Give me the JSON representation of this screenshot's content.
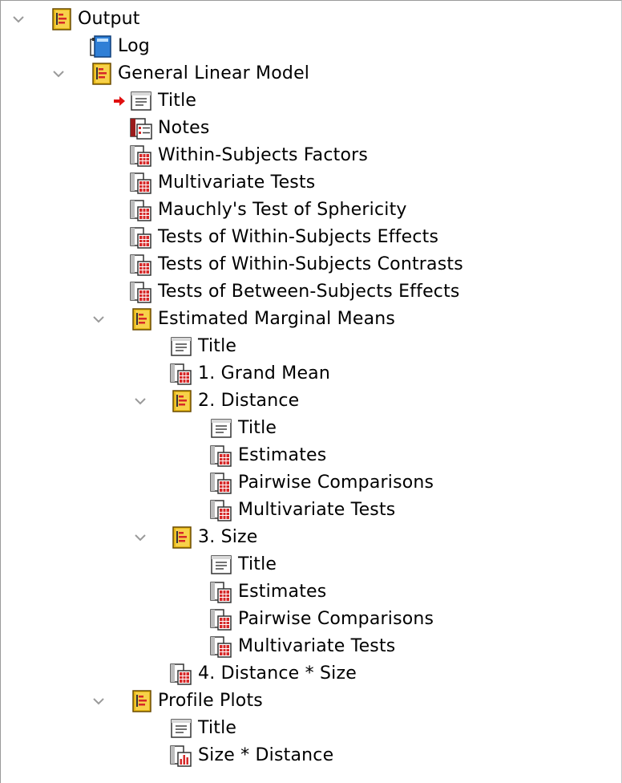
{
  "tree": {
    "root": {
      "label": "Output",
      "icon": "output-book-icon"
    },
    "log": {
      "label": "Log",
      "icon": "log-book-icon"
    },
    "glm": {
      "label": "General Linear Model",
      "icon": "procedure-book-icon",
      "items": [
        {
          "label": "Title",
          "icon": "title-icon",
          "selected_marker": "red-arrow-icon"
        },
        {
          "label": "Notes",
          "icon": "notes-icon"
        },
        {
          "label": "Within-Subjects Factors",
          "icon": "table-icon"
        },
        {
          "label": "Multivariate Tests",
          "icon": "table-icon"
        },
        {
          "label": "Mauchly's Test of Sphericity",
          "icon": "table-icon"
        },
        {
          "label": "Tests of Within-Subjects Effects",
          "icon": "table-icon"
        },
        {
          "label": "Tests of Within-Subjects Contrasts",
          "icon": "table-icon"
        },
        {
          "label": "Tests of Between-Subjects Effects",
          "icon": "table-icon"
        }
      ],
      "emm": {
        "label": "Estimated Marginal Means",
        "icon": "procedure-book-icon",
        "title": "Title",
        "grand_mean": "1. Grand Mean",
        "distance": {
          "label": "2. Distance",
          "items": [
            "Title",
            "Estimates",
            "Pairwise Comparisons",
            "Multivariate Tests"
          ]
        },
        "size": {
          "label": "3. Size",
          "items": [
            "Title",
            "Estimates",
            "Pairwise Comparisons",
            "Multivariate Tests"
          ]
        },
        "distance_size": "4. Distance * Size"
      },
      "profile": {
        "label": "Profile Plots",
        "icon": "procedure-book-icon",
        "items": [
          {
            "label": "Title",
            "icon": "title-icon"
          },
          {
            "label": "Size * Distance",
            "icon": "chart-icon"
          }
        ]
      }
    }
  },
  "colors": {
    "chevron": "#9a9a9a",
    "book_gold": "#e6b817",
    "book_red": "#d62828",
    "log_blue": "#2f7fd6",
    "selection_arrow": "#e01010"
  }
}
